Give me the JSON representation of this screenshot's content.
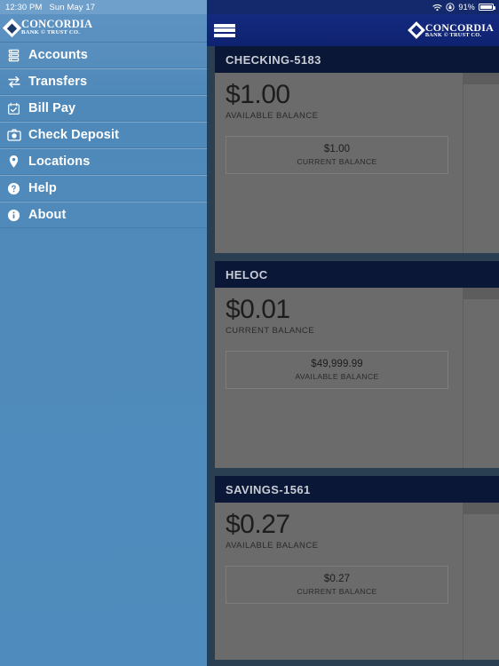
{
  "status_bar": {
    "time": "12:30 PM",
    "date": "Sun May 17",
    "battery_percent": "91%",
    "wifi_icon": "wifi-icon",
    "rotation_lock_icon": "rotation-lock-icon",
    "battery_icon": "battery-icon"
  },
  "brand": {
    "name": "CONCORDIA",
    "tagline": "BANK © TRUST CO."
  },
  "sidebar": {
    "items": [
      {
        "label": "Accounts",
        "icon": "accounts-icon"
      },
      {
        "label": "Transfers",
        "icon": "transfers-icon"
      },
      {
        "label": "Bill Pay",
        "icon": "bill-pay-icon"
      },
      {
        "label": "Check Deposit",
        "icon": "check-deposit-icon"
      },
      {
        "label": "Locations",
        "icon": "location-pin-icon"
      },
      {
        "label": "Help",
        "icon": "help-circle-icon"
      },
      {
        "label": "About",
        "icon": "info-circle-icon"
      }
    ]
  },
  "navbar": {
    "menu_icon": "hamburger-menu-icon"
  },
  "accounts": [
    {
      "title": "CHECKING-5183",
      "primary_amount": "$1.00",
      "primary_label": "AVAILABLE BALANCE",
      "secondary_amount": "$1.00",
      "secondary_label": "CURRENT BALANCE"
    },
    {
      "title": "HELOC",
      "primary_amount": "$0.01",
      "primary_label": "CURRENT BALANCE",
      "secondary_amount": "$49,999.99",
      "secondary_label": "AVAILABLE BALANCE"
    },
    {
      "title": "SAVINGS-1561",
      "primary_amount": "$0.27",
      "primary_label": "AVAILABLE BALANCE",
      "secondary_amount": "$0.27",
      "secondary_label": "CURRENT BALANCE"
    }
  ],
  "colors": {
    "sidebar_blue": "#4f8cbd",
    "navbar_navy": "#12287d",
    "card_header_navy": "#0b1736",
    "card_body_gray": "#6b6b6b",
    "page_background": "#2b3f52"
  }
}
